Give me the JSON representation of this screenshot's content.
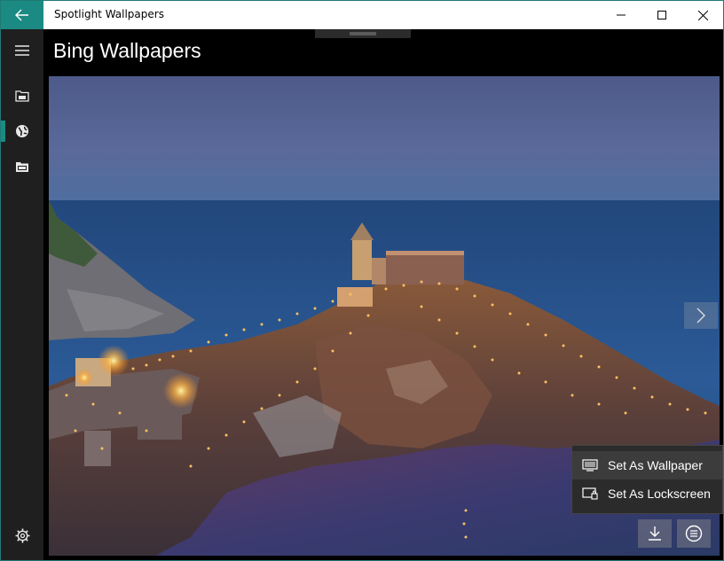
{
  "titlebar": {
    "app_title": "Spotlight Wallpapers",
    "back_icon": "arrow-left-icon",
    "minimize_icon": "minimize-icon",
    "maximize_icon": "maximize-icon",
    "close_icon": "close-icon"
  },
  "sidebar": {
    "items": [
      {
        "icon": "hamburger-menu-icon"
      },
      {
        "icon": "spotlight-folder-icon"
      },
      {
        "icon": "globe-icon",
        "active": true
      },
      {
        "icon": "saved-folder-icon"
      }
    ],
    "settings_icon": "gear-icon"
  },
  "header": {
    "title": "Bing Wallpapers"
  },
  "context_menu": {
    "items": [
      {
        "label": "Set As Wallpaper",
        "icon": "monitor-icon",
        "highlighted": true
      },
      {
        "label": "Set As Lockscreen",
        "icon": "lockscreen-icon",
        "highlighted": false
      }
    ]
  },
  "actions": {
    "download_icon": "download-icon",
    "menu_icon": "list-menu-icon",
    "next_icon": "chevron-right-icon"
  },
  "colors": {
    "accent": "#1a8a83",
    "sidebar_bg": "#1f1f1f",
    "menu_bg": "#2b2b2b"
  }
}
